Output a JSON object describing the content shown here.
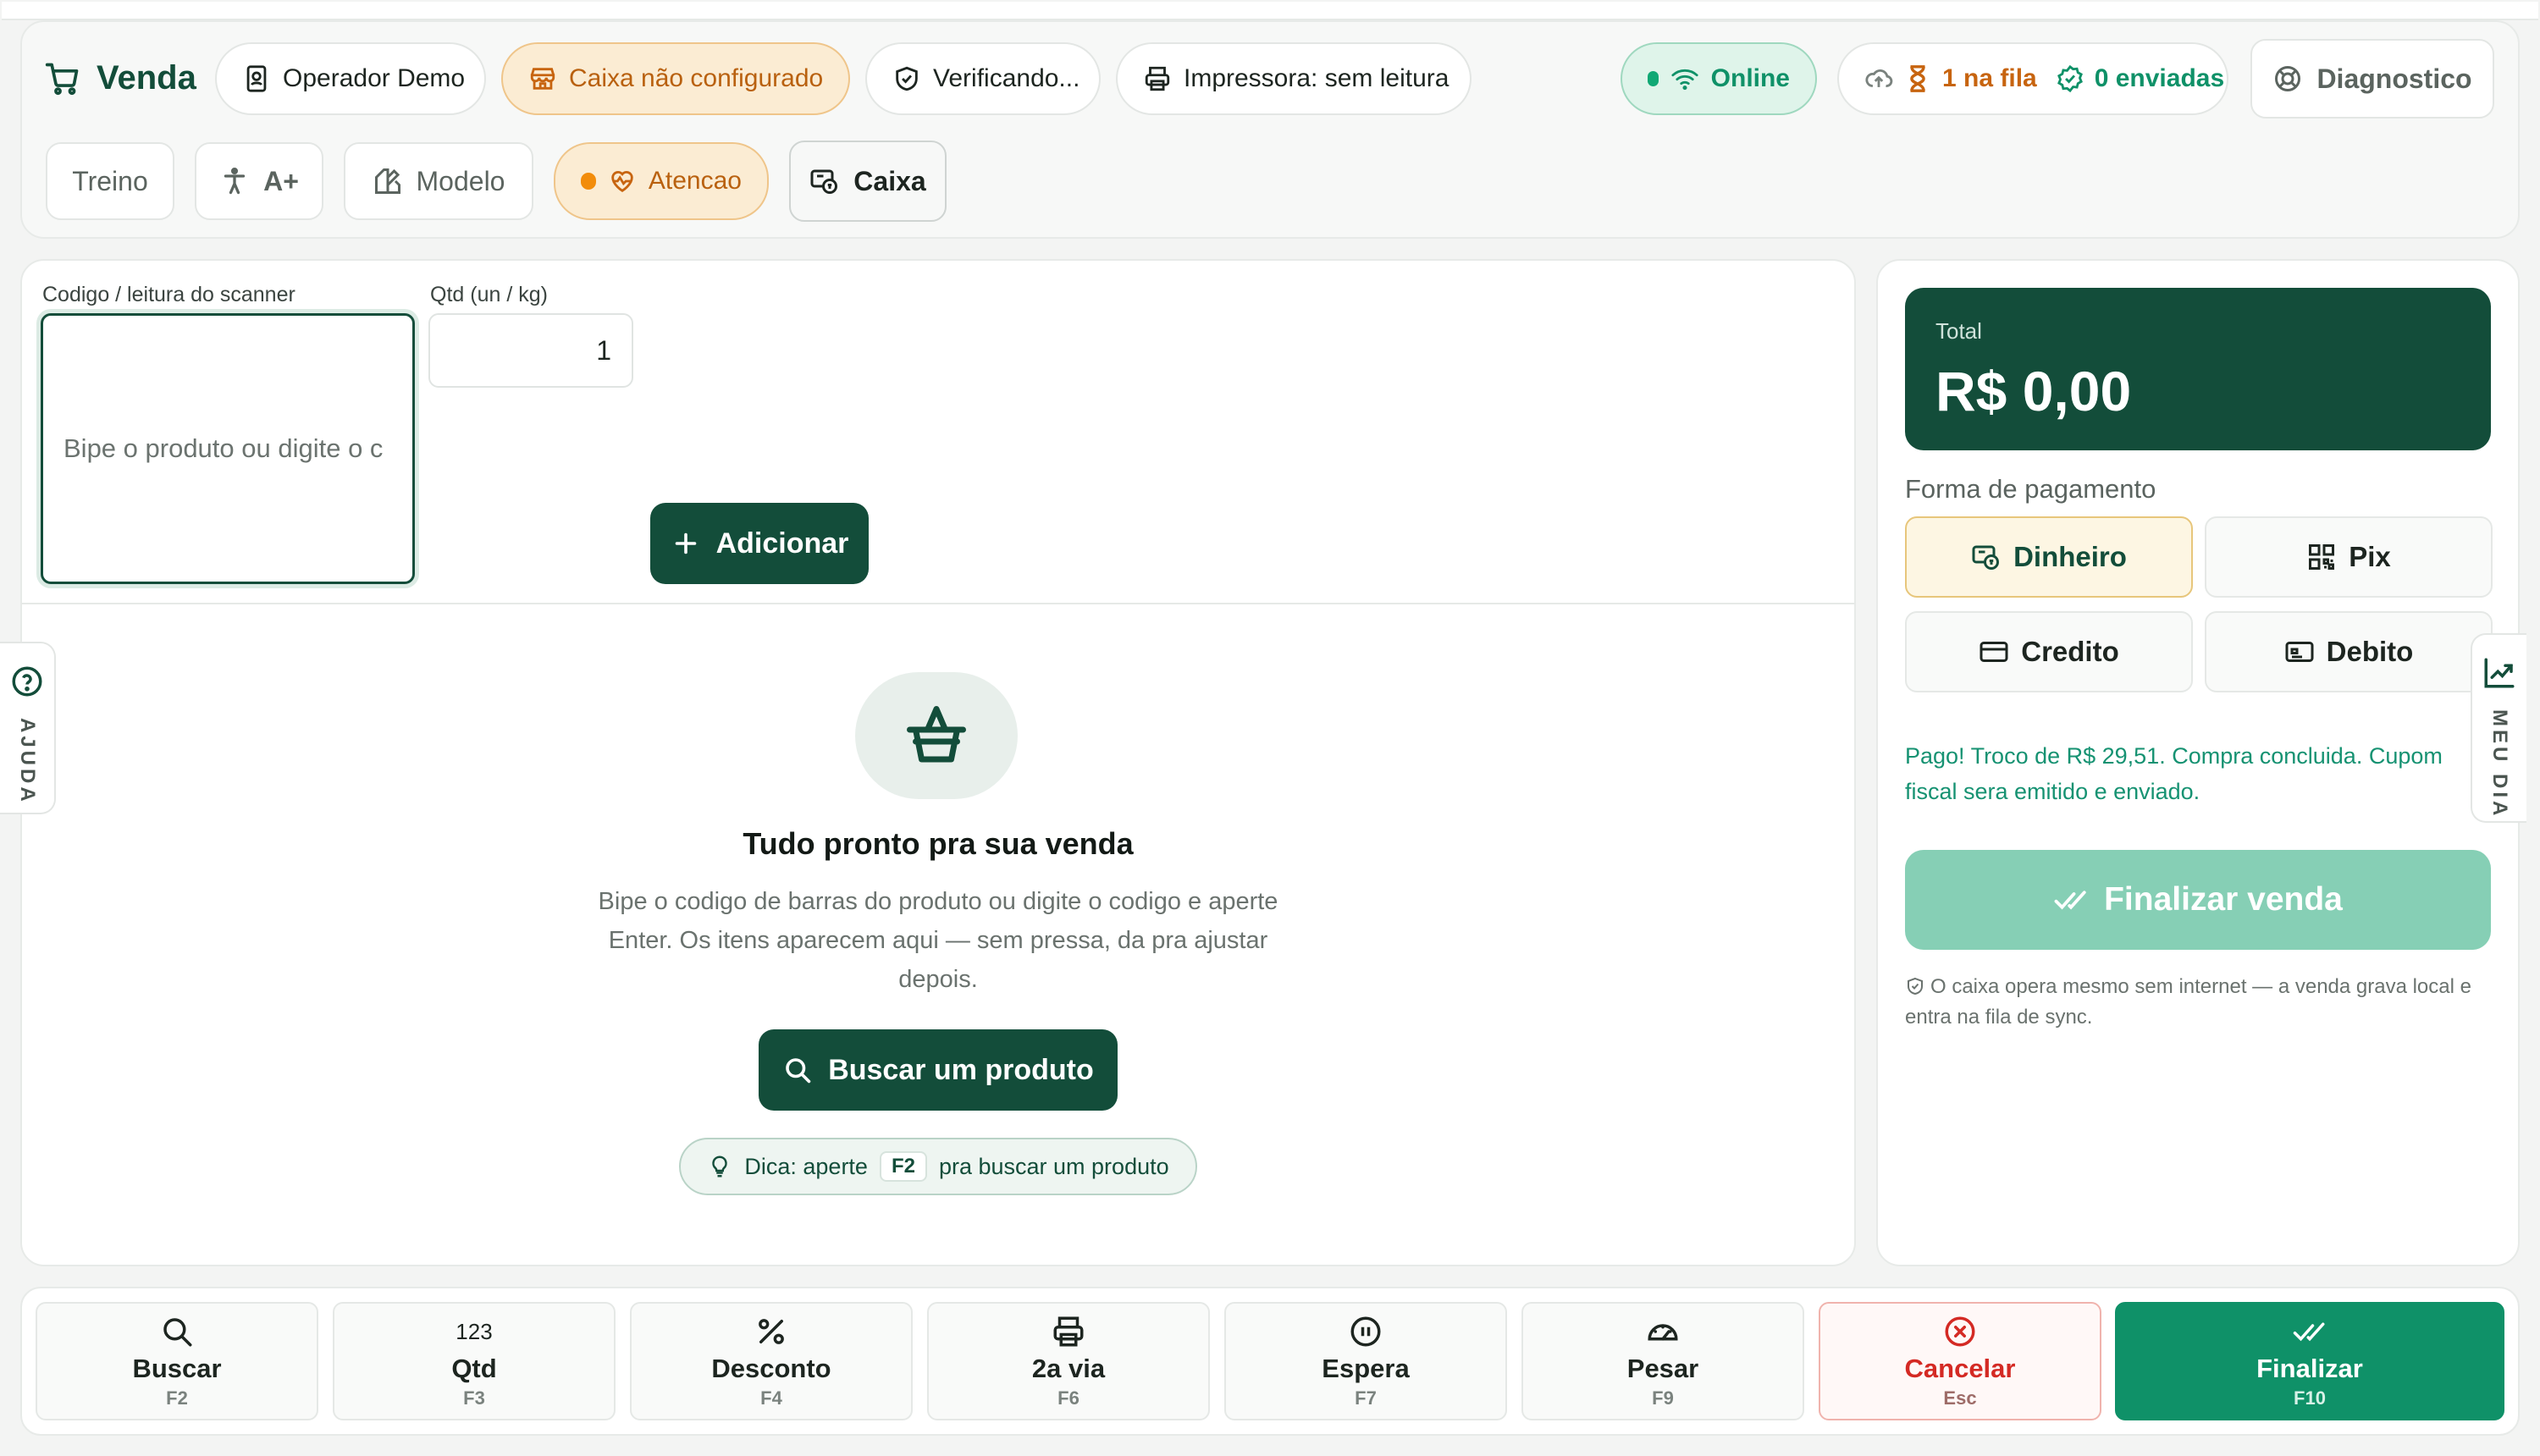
{
  "header": {
    "brand": "Venda",
    "operator": "Operador Demo",
    "cash_register": "Caixa não configurado",
    "verifying": "Verificando...",
    "printer": "Impressora: sem leitura",
    "online": "Online",
    "queue": "1 na fila",
    "sent": "0 enviadas",
    "diagnostics": "Diagnostico",
    "training": "Treino",
    "font_size": "A+",
    "model": "Modelo",
    "attention": "Atencao",
    "caixa": "Caixa"
  },
  "form": {
    "scan_label": "Codigo / leitura do scanner",
    "scan_placeholder": "Bipe o produto ou digite o c",
    "qty_label": "Qtd (un / kg)",
    "qty_value": "1",
    "add_button": "Adicionar"
  },
  "empty_state": {
    "title": "Tudo pronto pra sua venda",
    "description": "Bipe o codigo de barras do produto ou digite o codigo e aperte Enter. Os itens aparecem aqui — sem pressa, da pra ajustar depois.",
    "search_button": "Buscar um produto",
    "tip_prefix": "Dica: aperte",
    "tip_key": "F2",
    "tip_suffix": "pra buscar um produto"
  },
  "summary": {
    "total_label": "Total",
    "total_value": "R$ 0,00",
    "payment_label": "Forma de pagamento",
    "payment_methods": [
      "Dinheiro",
      "Pix",
      "Credito",
      "Debito"
    ],
    "selected_method": "Dinheiro",
    "status_message": "Pago! Troco de R$ 29,51. Compra concluida. Cupom fiscal sera emitido e enviado.",
    "finalize_button": "Finalizar venda",
    "offline_note": "O caixa opera mesmo sem internet — a venda grava local e entra na fila de sync."
  },
  "side_tabs": {
    "help": "AJUDA",
    "my_day": "MEU DIA"
  },
  "function_keys": [
    {
      "label": "Buscar",
      "key": "F2",
      "icon": "search-icon"
    },
    {
      "label": "Qtd",
      "key": "F3",
      "icon": "123"
    },
    {
      "label": "Desconto",
      "key": "F4",
      "icon": "percent-icon"
    },
    {
      "label": "2a via",
      "key": "F6",
      "icon": "printer-icon"
    },
    {
      "label": "Espera",
      "key": "F7",
      "icon": "pause-icon"
    },
    {
      "label": "Pesar",
      "key": "F9",
      "icon": "gauge-icon"
    },
    {
      "label": "Cancelar",
      "key": "Esc",
      "icon": "x-circle-icon"
    },
    {
      "label": "Finalizar",
      "key": "F10",
      "icon": "double-check-icon"
    }
  ],
  "colors": {
    "brand": "#134d3a",
    "accent": "#0f9168",
    "warning": "#c7640f",
    "danger": "#d42a24",
    "success_text": "#169272"
  }
}
